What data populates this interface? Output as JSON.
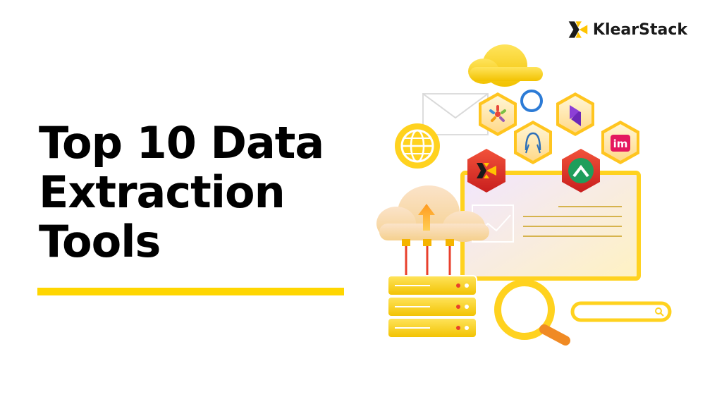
{
  "brand": {
    "name": "KlearStack",
    "accent_color": "#ffd600",
    "icon": "klearstack-x-logo"
  },
  "headline": {
    "lines": [
      "Top 10 Data",
      "Extraction",
      "Tools"
    ]
  },
  "illustration": {
    "icons": [
      "cloud-icon",
      "envelope-icon",
      "globe-icon",
      "sisense-logo-icon",
      "sparkle-logo-icon",
      "gitkraken-octopus-icon",
      "stack-logo-icon",
      "klearstack-x-icon",
      "upward-arrow-logo-icon",
      "upload-cloud-icon",
      "server-icon",
      "browser-window-icon",
      "magnifier-icon",
      "search-bar-icon"
    ],
    "im_badge_text": "im"
  }
}
